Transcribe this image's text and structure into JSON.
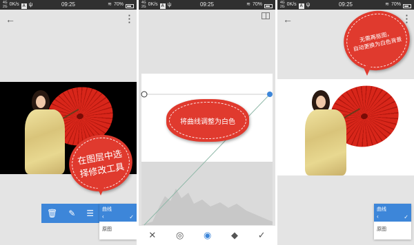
{
  "status": {
    "network_top": "4G",
    "network_bottom": "2G",
    "speed": "0K/s",
    "app_badge": "A",
    "time": "09:25",
    "battery": "70%"
  },
  "panel1": {
    "callout": "在图层中选择修改工具",
    "toolbar_icons": [
      "trash-icon",
      "edit-icon",
      "sliders-icon"
    ],
    "menu": {
      "header": "曲线",
      "header_back": "‹",
      "header_check": "✓",
      "item": "原图"
    }
  },
  "panel2": {
    "callout": "将曲线调整为白色",
    "bottom_icons": [
      "close-icon",
      "tone-icon",
      "eye-icon",
      "eraser-icon",
      "check-icon"
    ]
  },
  "panel3": {
    "callout_line1": "无需再抠图，",
    "callout_line2": "自动更换为白色背景",
    "menu": {
      "header": "曲线",
      "header_back": "‹",
      "header_check": "✓",
      "item": "原图"
    }
  },
  "colors": {
    "accent": "#3d86d9",
    "callout": "#e03a2e",
    "statusbar": "#303030"
  }
}
